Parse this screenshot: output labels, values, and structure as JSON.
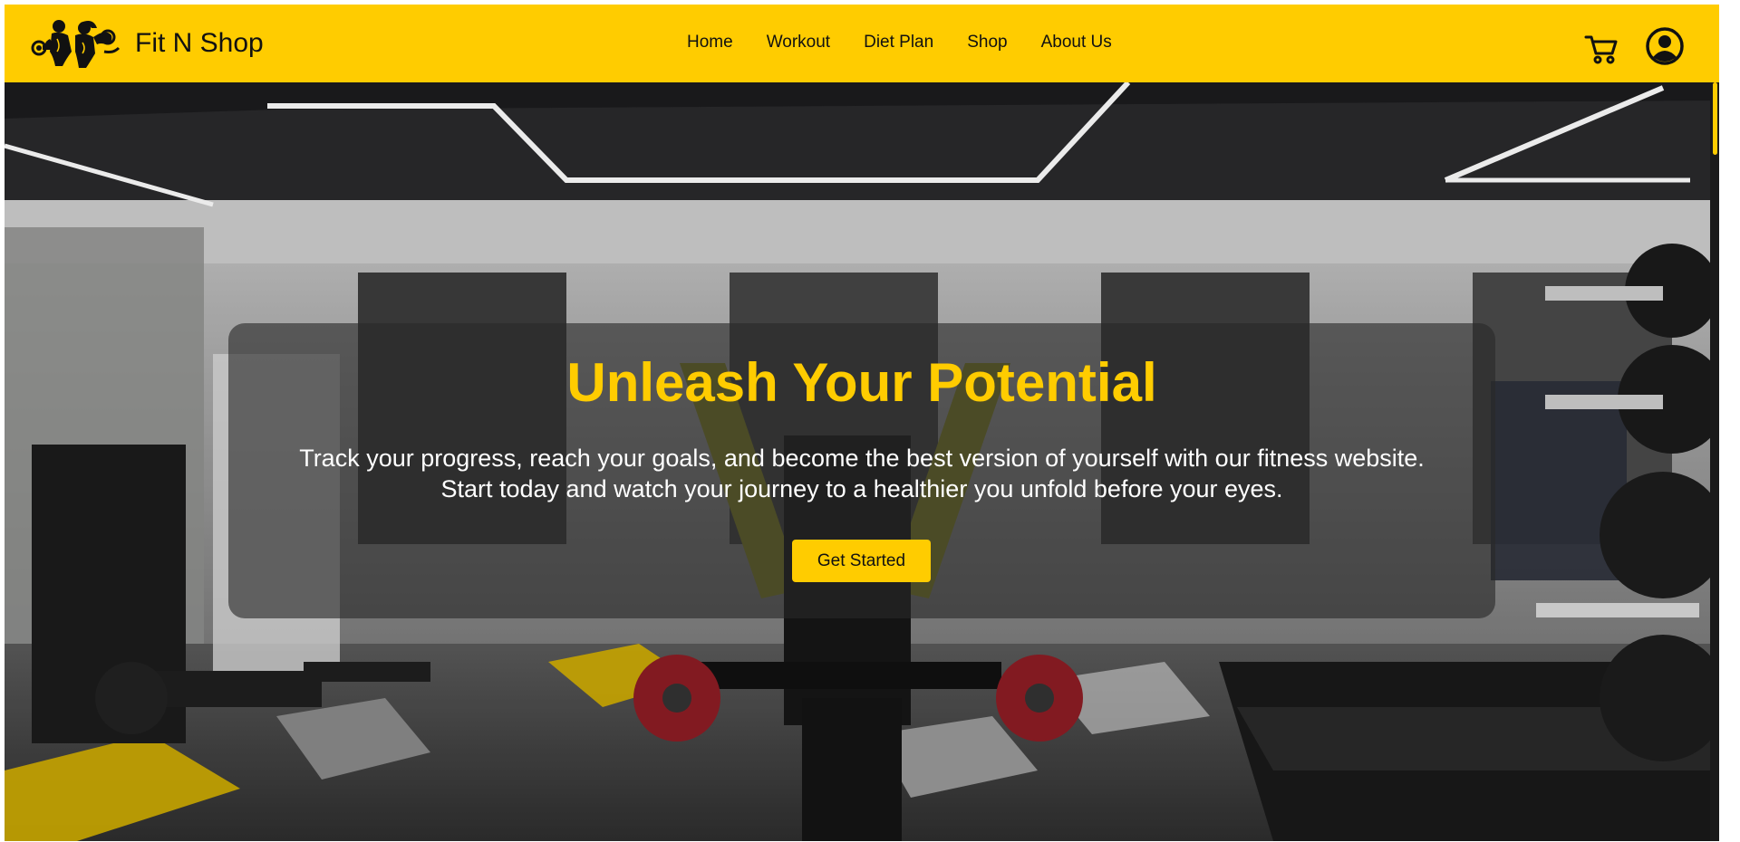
{
  "brand": {
    "name": "Fit N Shop",
    "logo_icon": "bodybuilder-couple-logo"
  },
  "nav": {
    "links": [
      "Home",
      "Workout",
      "Diet Plan",
      "Shop",
      "About Us"
    ]
  },
  "header_actions": {
    "cart_icon": "cart-icon",
    "user_icon": "user-account-icon"
  },
  "hero": {
    "headline": "Unleash Your Potential",
    "tagline": "Track your progress, reach your goals, and become the best version of yourself with our fitness website. Start today and watch your journey to a healthier you unfold before your eyes.",
    "cta_label": "Get Started"
  },
  "colors": {
    "accent": "#ffcc00",
    "text_dark": "#111111",
    "text_light": "#ffffff"
  }
}
